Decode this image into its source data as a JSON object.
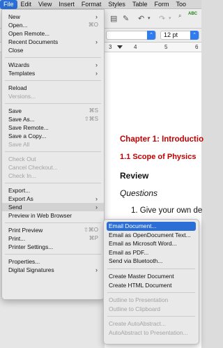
{
  "menubar": {
    "items": [
      "File",
      "Edit",
      "View",
      "Insert",
      "Format",
      "Styles",
      "Table",
      "Form",
      "Too"
    ]
  },
  "toolbar": {
    "font_size": "12 pt"
  },
  "ruler": {
    "labels": [
      "3",
      "4",
      "5",
      "6"
    ]
  },
  "document": {
    "chapter_title": "Chapter 1:  Introductio",
    "section_title": "1.1 Scope of Physics",
    "review": "Review",
    "questions": "Questions",
    "q1": "1.  Give your own de"
  },
  "file_menu": {
    "new": {
      "label": "New",
      "chevron": "›"
    },
    "open": {
      "label": "Open...",
      "shortcut": "⌘O"
    },
    "open_remote": {
      "label": "Open Remote..."
    },
    "recent": {
      "label": "Recent Documents",
      "chevron": "›"
    },
    "close": {
      "label": "Close"
    },
    "wizards": {
      "label": "Wizards",
      "chevron": "›"
    },
    "templates": {
      "label": "Templates",
      "chevron": "›"
    },
    "reload": {
      "label": "Reload"
    },
    "versions": {
      "label": "Versions..."
    },
    "save": {
      "label": "Save",
      "shortcut": "⌘S"
    },
    "save_as": {
      "label": "Save As...",
      "shortcut": "⇧⌘S"
    },
    "save_remote": {
      "label": "Save Remote..."
    },
    "save_copy": {
      "label": "Save a Copy..."
    },
    "save_all": {
      "label": "Save All"
    },
    "check_out": {
      "label": "Check Out"
    },
    "cancel_checkout": {
      "label": "Cancel Checkout..."
    },
    "check_in": {
      "label": "Check In..."
    },
    "export": {
      "label": "Export..."
    },
    "export_as": {
      "label": "Export As",
      "chevron": "›"
    },
    "send": {
      "label": "Send",
      "chevron": "›"
    },
    "preview_web": {
      "label": "Preview in Web Browser"
    },
    "print_preview": {
      "label": "Print Preview",
      "shortcut": "⇧⌘O"
    },
    "print": {
      "label": "Print...",
      "shortcut": "⌘P"
    },
    "printer_settings": {
      "label": "Printer Settings..."
    },
    "properties": {
      "label": "Properties..."
    },
    "digital_signatures": {
      "label": "Digital Signatures",
      "chevron": "›"
    }
  },
  "send_menu": {
    "email_document": "Email Document...",
    "email_odt": "Email as OpenDocument Text...",
    "email_word": "Email as Microsoft Word...",
    "email_pdf": "Email as PDF...",
    "send_bluetooth": "Send via Bluetooth...",
    "create_master": "Create Master Document",
    "create_html": "Create HTML Document",
    "outline_presentation": "Outline to Presentation",
    "outline_clipboard": "Outline to Clipboard",
    "create_autoabstract": "Create AutoAbstract...",
    "autoabstract_presentation": "AutoAbstract to Presentation..."
  }
}
